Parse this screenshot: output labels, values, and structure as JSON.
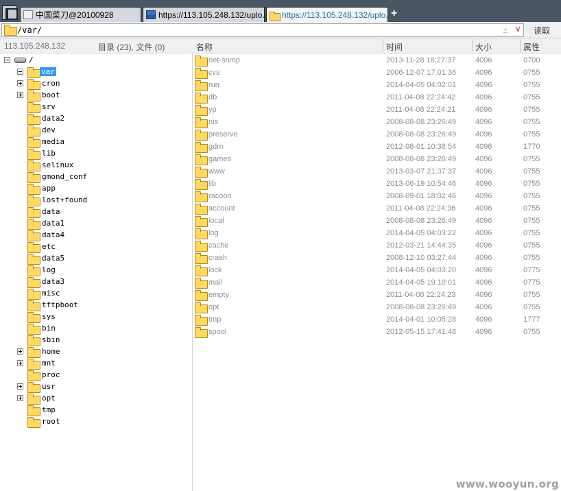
{
  "tabs": [
    {
      "label": "中国菜刀@20100928",
      "icon": "page-icon",
      "active": false
    },
    {
      "label": "https://113.105.248.132/uplo...",
      "icon": "flag-icon",
      "active": false
    },
    {
      "label": "https://113.105.248.132/uplo...",
      "icon": "folder-icon",
      "active": true
    }
  ],
  "new_tab_label": "+",
  "address": {
    "path": "/var/",
    "plusminus": "±",
    "dropdown": "∨",
    "read_label": "读取"
  },
  "tree": {
    "host": "113.105.248.132",
    "count": "目录 (23), 文件 (0)",
    "root_label": "/",
    "items": [
      {
        "label": "var",
        "expander": "minus",
        "selected": true
      },
      {
        "label": "cron",
        "expander": "plus"
      },
      {
        "label": "boot",
        "expander": "plus"
      },
      {
        "label": "srv",
        "expander": "none"
      },
      {
        "label": "data2",
        "expander": "none"
      },
      {
        "label": "dev",
        "expander": "none"
      },
      {
        "label": "media",
        "expander": "none"
      },
      {
        "label": "lib",
        "expander": "none"
      },
      {
        "label": "selinux",
        "expander": "none"
      },
      {
        "label": "gmond_conf",
        "expander": "none"
      },
      {
        "label": "app",
        "expander": "none"
      },
      {
        "label": "lost+found",
        "expander": "none"
      },
      {
        "label": "data",
        "expander": "none"
      },
      {
        "label": "data1",
        "expander": "none"
      },
      {
        "label": "data4",
        "expander": "none"
      },
      {
        "label": "etc",
        "expander": "none"
      },
      {
        "label": "data5",
        "expander": "none"
      },
      {
        "label": "log",
        "expander": "none"
      },
      {
        "label": "data3",
        "expander": "none"
      },
      {
        "label": "misc",
        "expander": "none"
      },
      {
        "label": "tftpboot",
        "expander": "none"
      },
      {
        "label": "sys",
        "expander": "none"
      },
      {
        "label": "bin",
        "expander": "none"
      },
      {
        "label": "sbin",
        "expander": "none"
      },
      {
        "label": "home",
        "expander": "plus"
      },
      {
        "label": "mnt",
        "expander": "plus"
      },
      {
        "label": "proc",
        "expander": "none"
      },
      {
        "label": "usr",
        "expander": "plus"
      },
      {
        "label": "opt",
        "expander": "plus"
      },
      {
        "label": "tmp",
        "expander": "none"
      },
      {
        "label": "root",
        "expander": "none"
      }
    ]
  },
  "list": {
    "columns": {
      "name": "名称",
      "time": "时间",
      "size": "大小",
      "attr": "属性"
    },
    "rows": [
      {
        "name": "net-snmp",
        "time": "2013-11-28 18:27:37",
        "size": "4096",
        "attr": "0700"
      },
      {
        "name": "cvs",
        "time": "2006-12-07 17:01:36",
        "size": "4096",
        "attr": "0755"
      },
      {
        "name": "run",
        "time": "2014-04-05 04:02:01",
        "size": "4096",
        "attr": "0755"
      },
      {
        "name": "db",
        "time": "2011-04-08 22:24:42",
        "size": "4096",
        "attr": "0755"
      },
      {
        "name": "yp",
        "time": "2011-04-08 22:24:21",
        "size": "4096",
        "attr": "0755"
      },
      {
        "name": "nis",
        "time": "2008-08-08 23:26:49",
        "size": "4096",
        "attr": "0755"
      },
      {
        "name": "preserve",
        "time": "2008-08-08 23:26:49",
        "size": "4096",
        "attr": "0755"
      },
      {
        "name": "gdm",
        "time": "2012-08-01 10:38:54",
        "size": "4096",
        "attr": "1770"
      },
      {
        "name": "games",
        "time": "2008-08-08 23:26:49",
        "size": "4096",
        "attr": "0755"
      },
      {
        "name": "www",
        "time": "2013-03-07 21:37:37",
        "size": "4096",
        "attr": "0755"
      },
      {
        "name": "lib",
        "time": "2013-06-19 10:54:46",
        "size": "4096",
        "attr": "0755"
      },
      {
        "name": "racoon",
        "time": "2008-09-01 18:02:46",
        "size": "4096",
        "attr": "0755"
      },
      {
        "name": "account",
        "time": "2011-04-08 22:24:36",
        "size": "4096",
        "attr": "0755"
      },
      {
        "name": "local",
        "time": "2008-08-08 23:26:49",
        "size": "4096",
        "attr": "0755"
      },
      {
        "name": "log",
        "time": "2014-04-05 04:03:22",
        "size": "4096",
        "attr": "0755"
      },
      {
        "name": "cache",
        "time": "2012-03-21 14:44:35",
        "size": "4096",
        "attr": "0755"
      },
      {
        "name": "crash",
        "time": "2008-12-10 03:27:44",
        "size": "4096",
        "attr": "0755"
      },
      {
        "name": "lock",
        "time": "2014-04-05 04:03:20",
        "size": "4096",
        "attr": "0775"
      },
      {
        "name": "mail",
        "time": "2014-04-05 19:10:01",
        "size": "4096",
        "attr": "0775"
      },
      {
        "name": "empty",
        "time": "2011-04-08 22:24:23",
        "size": "4096",
        "attr": "0755"
      },
      {
        "name": "opt",
        "time": "2008-08-08 23:26:49",
        "size": "4096",
        "attr": "0755"
      },
      {
        "name": "tmp",
        "time": "2014-04-01 10:05:28",
        "size": "4096",
        "attr": "1777"
      },
      {
        "name": "spool",
        "time": "2012-05-15 17:41:48",
        "size": "4096",
        "attr": "0755"
      }
    ]
  },
  "watermark": "www.wooyun.org"
}
